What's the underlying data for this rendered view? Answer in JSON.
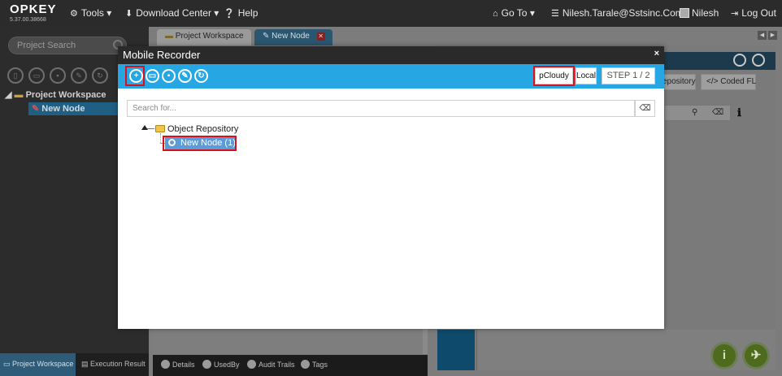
{
  "app": {
    "logo": "OPKEY",
    "version": "5.37.00.38668"
  },
  "topnav": {
    "tools": "Tools",
    "download_center": "Download Center",
    "help": "Help",
    "go_to": "Go To",
    "user_email": "Nilesh.Tarale@Sstsinc.Com",
    "user_name": "Nilesh",
    "logout": "Log Out"
  },
  "left_panel": {
    "search_placeholder": "Project Search",
    "tree_root": "Project Workspace",
    "tree_node": "New Node",
    "bottom_tabs": [
      "Project Workspace",
      "Execution Result"
    ]
  },
  "editor_tabs": [
    {
      "label": "Project Workspace"
    },
    {
      "label": "New Node"
    }
  ],
  "right_panel": {
    "repository_btn": "epository",
    "coded_btn": "</> Coded FL"
  },
  "mid_bottom_tabs": [
    "Details",
    "UsedBy",
    "Audit Trails",
    "Tags"
  ],
  "modal": {
    "title": "Mobile Recorder",
    "close": "×",
    "toolbar": {
      "icons": [
        "add-icon",
        "folder-icon",
        "delete-icon",
        "edit-icon",
        "refresh-icon"
      ],
      "pcloudy_label": "pCloudy",
      "local_label": "Local",
      "step_label": "STEP 1 / 2"
    },
    "search_placeholder": "Search for...",
    "tree": {
      "root": "Object Repository",
      "child": "New Node (1)"
    }
  },
  "colors": {
    "toolbar_blue": "#26a7e4",
    "highlight_red": "#d8111b",
    "selected_node": "#5a9bd8"
  }
}
